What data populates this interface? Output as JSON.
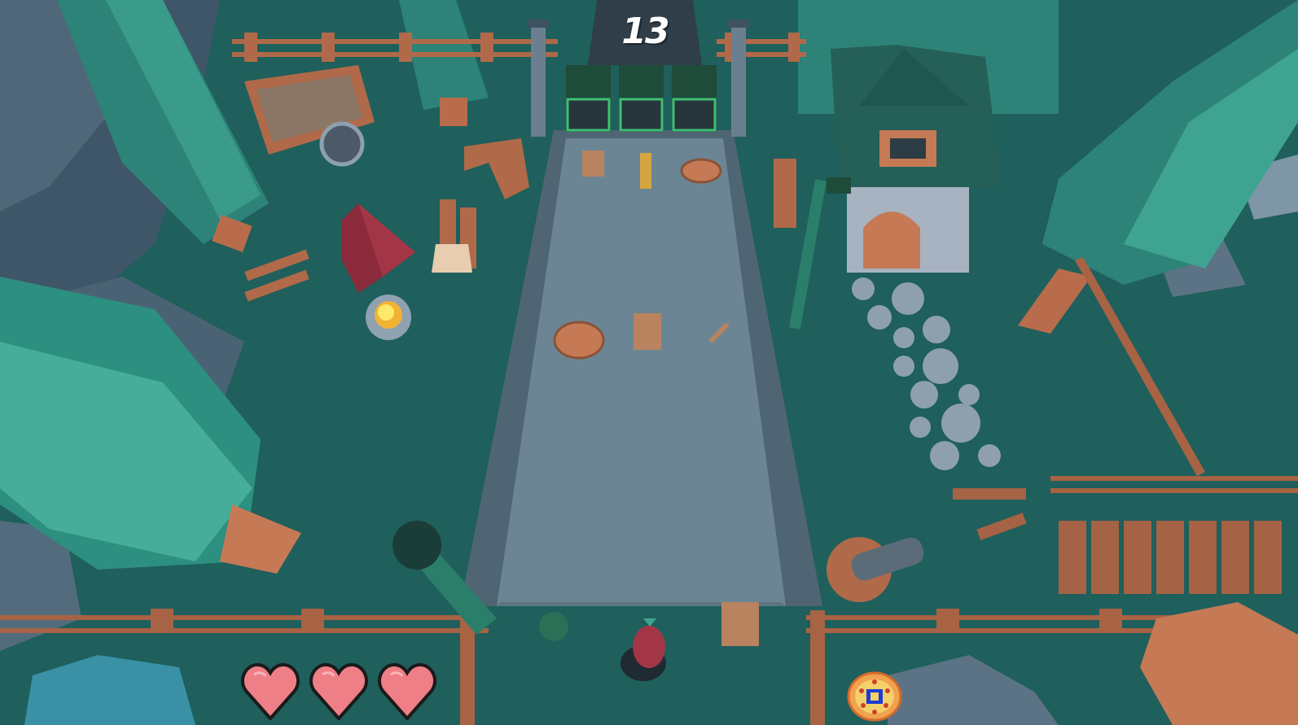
{
  "hud": {
    "score": "13",
    "lives": 3
  },
  "icons": {
    "life": "heart-icon",
    "item": "pizza-icon"
  },
  "colors": {
    "ground": "#1f5f5c",
    "road": "#6c8594",
    "heart": "#ef7f86",
    "score_panel": "#2f3e48"
  }
}
